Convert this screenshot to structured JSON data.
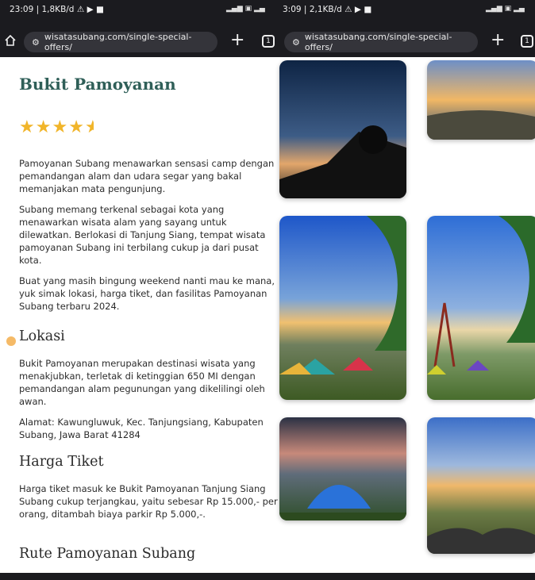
{
  "status_left": {
    "time": "23:09",
    "speed": "1,8KB/d",
    "icons": "⚠ ▶ ■"
  },
  "status_right": {
    "time": "3:09",
    "speed": "2,1KB/d",
    "icons": "⚠ ▶ ■"
  },
  "browser": {
    "url_left": "wisatasubang.com/single-special-offers/",
    "url_right": "wisatasubang.com/single-special-offers/",
    "tab_count": "1"
  },
  "article": {
    "title": "Bukit Pamoyanan",
    "rating": 4.5,
    "paragraphs": [
      "Pamoyanan Subang menawarkan sensasi camp dengan pemandangan alam dan udara segar yang bakal memanjakan mata pengunjung.",
      "Subang memang terkenal sebagai kota yang menawarkan wisata alam yang sayang untuk dilewatkan. Berlokasi di Tanjung Siang, tempat wisata pamoyanan Subang ini terbilang cukup ja dari pusat kota.",
      "Buat yang masih bingung weekend nanti mau ke mana, yuk simak lokasi, harga tiket, dan fasilitas Pamoyanan Subang terbaru 2024."
    ],
    "lokasi": {
      "heading": "Lokasi",
      "desc": "Bukit Pamoyanan merupakan destinasi wisata yang menakjubkan, terletak di ketinggian 650 MI dengan pemandangan alam pegunungan yang dikelilingi oleh awan.",
      "address": "Alamat: Kawungluwuk, Kec. Tanjungsiang, Kabupaten Subang, Jawa Barat 41284"
    },
    "harga": {
      "heading": "Harga Tiket",
      "desc": "Harga tiket masuk ke Bukit Pamoyanan Tanjung Siang Subang cukup terjangkau, yaitu sebesar Rp 15.000,- per orang, ditambah biaya parkir Rp 5.000,-."
    },
    "rute": {
      "heading": "Rute Pamoyanan Subang"
    }
  },
  "colors": {
    "title": "#2f5f58",
    "stars": "#f1b52a",
    "chrome": "#1b1b1f"
  }
}
